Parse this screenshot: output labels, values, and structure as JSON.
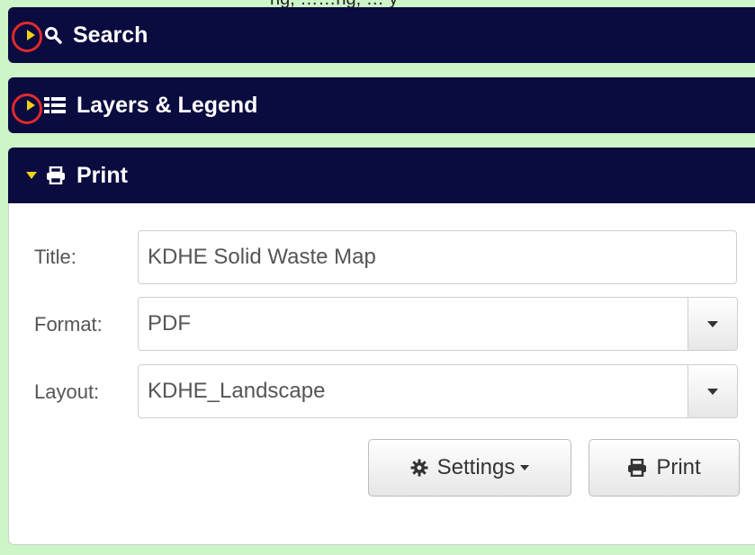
{
  "top_clip_text": "ng, ……ng, … y",
  "panels": {
    "search": {
      "label": "Search",
      "icon": "search-icon",
      "state": "collapsed"
    },
    "layers": {
      "label": "Layers & Legend",
      "icon": "list-icon",
      "state": "collapsed"
    },
    "print": {
      "label": "Print",
      "icon": "printer-icon",
      "state": "expanded"
    }
  },
  "print_form": {
    "title_label": "Title:",
    "title_value": "KDHE Solid Waste Map",
    "format_label": "Format:",
    "format_value": "PDF",
    "layout_label": "Layout:",
    "layout_value": "KDHE_Landscape",
    "settings_button": "Settings",
    "print_button": "Print"
  },
  "colors": {
    "header_bg": "#0a0b3f",
    "caret": "#f1cf13",
    "highlight_ring": "#e02a2a",
    "page_bg": "#ccf5c8"
  }
}
